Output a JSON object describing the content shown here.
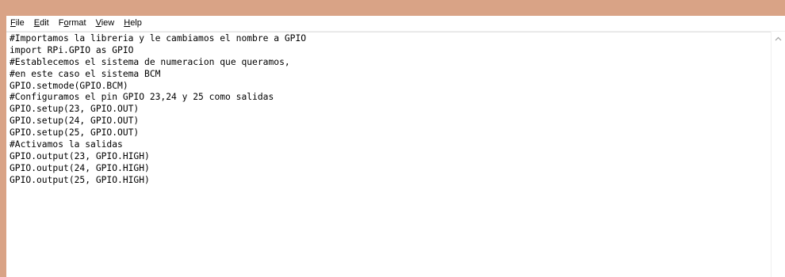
{
  "menubar": {
    "items": [
      {
        "mnemonic": "F",
        "rest": "ile"
      },
      {
        "mnemonic": "E",
        "rest": "dit"
      },
      {
        "pre": "F",
        "mnemonic": "o",
        "rest": "rmat"
      },
      {
        "mnemonic": "V",
        "rest": "iew"
      },
      {
        "mnemonic": "H",
        "rest": "elp"
      }
    ]
  },
  "editor": {
    "lines": [
      "#Importamos la libreria y le cambiamos el nombre a GPIO",
      "import RPi.GPIO as GPIO",
      "#Establecemos el sistema de numeracion que queramos,",
      "#en este caso el sistema BCM",
      "GPIO.setmode(GPIO.BCM)",
      "#Configuramos el pin GPIO 23,24 y 25 como salidas",
      "GPIO.setup(23, GPIO.OUT)",
      "GPIO.setup(24, GPIO.OUT)",
      "GPIO.setup(25, GPIO.OUT)",
      "#Activamos la salidas",
      "GPIO.output(23, GPIO.HIGH)",
      "GPIO.output(24, GPIO.HIGH)",
      "GPIO.output(25, GPIO.HIGH)"
    ]
  },
  "scrollbar": {
    "up_icon": "chevron-up-icon"
  },
  "colors": {
    "window_frame": "#d9a386",
    "background": "#ffffff",
    "text": "#000000"
  }
}
